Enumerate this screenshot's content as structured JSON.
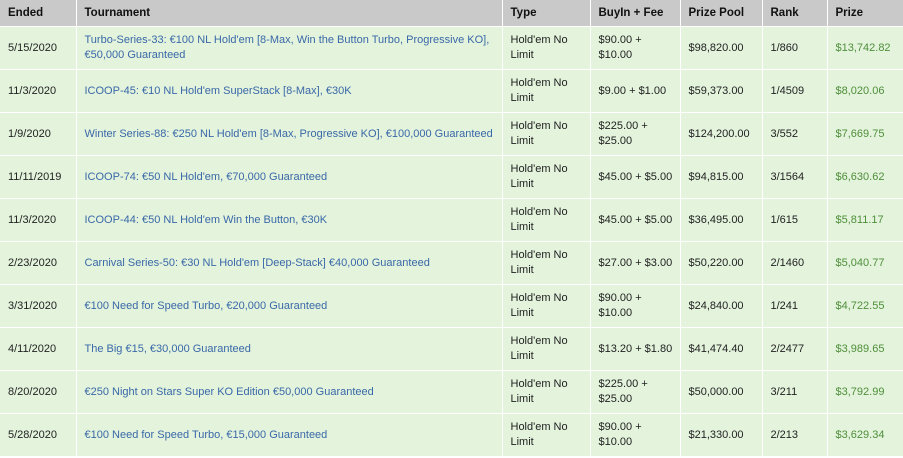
{
  "columns": [
    "Ended",
    "Tournament",
    "Type",
    "BuyIn + Fee",
    "Prize Pool",
    "Rank",
    "Prize"
  ],
  "rows": [
    {
      "ended": "5/15/2020",
      "tournament": "Turbo-Series-33: €100 NL Hold'em [8-Max, Win the Button Turbo, Progressive KO], €50,000 Guaranteed",
      "type": "Hold'em No Limit",
      "buyin": "$90.00 + $10.00",
      "pool": "$98,820.00",
      "rank": "1/860",
      "prize": "$13,742.82"
    },
    {
      "ended": "11/3/2020",
      "tournament": "ICOOP-45: €10 NL Hold'em SuperStack [8-Max], €30K",
      "type": "Hold'em No Limit",
      "buyin": "$9.00 + $1.00",
      "pool": "$59,373.00",
      "rank": "1/4509",
      "prize": "$8,020.06"
    },
    {
      "ended": "1/9/2020",
      "tournament": "Winter Series-88: €250 NL Hold'em [8-Max, Progressive KO], €100,000 Guaranteed",
      "type": "Hold'em No Limit",
      "buyin": "$225.00 + $25.00",
      "pool": "$124,200.00",
      "rank": "3/552",
      "prize": "$7,669.75"
    },
    {
      "ended": "11/11/2019",
      "tournament": "ICOOP-74: €50 NL Hold'em, €70,000 Guaranteed",
      "type": "Hold'em No Limit",
      "buyin": "$45.00 + $5.00",
      "pool": "$94,815.00",
      "rank": "3/1564",
      "prize": "$6,630.62"
    },
    {
      "ended": "11/3/2020",
      "tournament": "ICOOP-44: €50 NL Hold'em Win the Button, €30K",
      "type": "Hold'em No Limit",
      "buyin": "$45.00 + $5.00",
      "pool": "$36,495.00",
      "rank": "1/615",
      "prize": "$5,811.17"
    },
    {
      "ended": "2/23/2020",
      "tournament": "Carnival Series-50: €30 NL Hold'em [Deep-Stack] €40,000 Guaranteed",
      "type": "Hold'em No Limit",
      "buyin": "$27.00 + $3.00",
      "pool": "$50,220.00",
      "rank": "2/1460",
      "prize": "$5,040.77"
    },
    {
      "ended": "3/31/2020",
      "tournament": "€100 Need for Speed Turbo, €20,000 Guaranteed",
      "type": "Hold'em No Limit",
      "buyin": "$90.00 + $10.00",
      "pool": "$24,840.00",
      "rank": "1/241",
      "prize": "$4,722.55"
    },
    {
      "ended": "4/11/2020",
      "tournament": "The Big €15, €30,000 Guaranteed",
      "type": "Hold'em No Limit",
      "buyin": "$13.20 + $1.80",
      "pool": "$41,474.40",
      "rank": "2/2477",
      "prize": "$3,989.65"
    },
    {
      "ended": "8/20/2020",
      "tournament": "€250 Night on Stars Super KO Edition €50,000 Guaranteed",
      "type": "Hold'em No Limit",
      "buyin": "$225.00 + $25.00",
      "pool": "$50,000.00",
      "rank": "3/211",
      "prize": "$3,792.99"
    },
    {
      "ended": "5/28/2020",
      "tournament": "€100 Need for Speed Turbo, €15,000 Guaranteed",
      "type": "Hold'em No Limit",
      "buyin": "$90.00 + $10.00",
      "pool": "$21,330.00",
      "rank": "2/213",
      "prize": "$3,629.34"
    }
  ]
}
